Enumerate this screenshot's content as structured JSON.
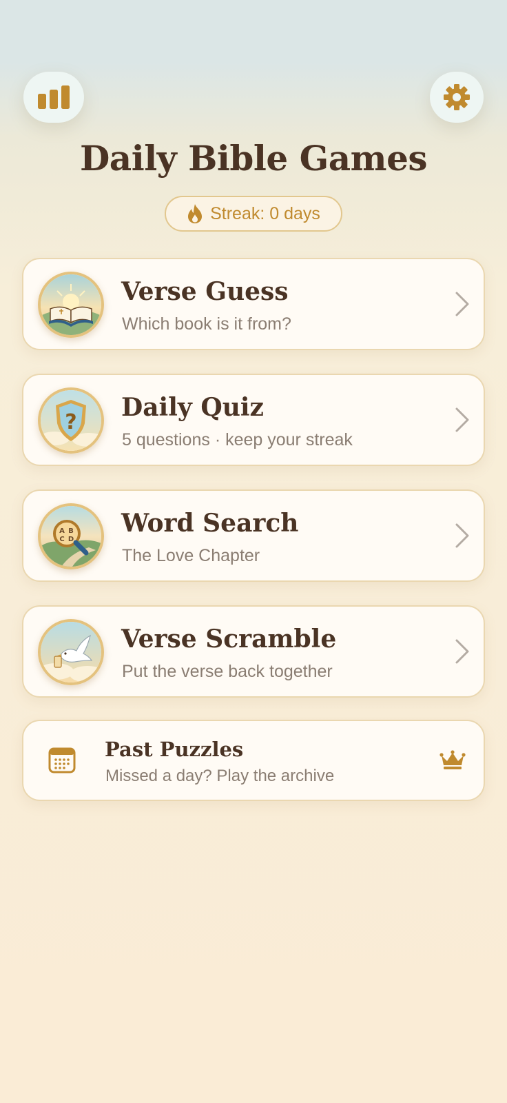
{
  "header": {
    "stats_icon": "bar-chart-icon",
    "settings_icon": "gear-icon",
    "title": "Daily Bible Games"
  },
  "streak": {
    "icon": "flame-icon",
    "label": "Streak: 0 days"
  },
  "games": [
    {
      "title": "Verse Guess",
      "subtitle": "Which book is it from?",
      "icon": "open-bible-icon"
    },
    {
      "title": "Daily Quiz",
      "subtitle": "5 questions · keep your streak",
      "icon": "question-shield-icon"
    },
    {
      "title": "Word Search",
      "subtitle": "The Love Chapter",
      "icon": "magnifier-letters-icon"
    },
    {
      "title": "Verse Scramble",
      "subtitle": "Put the verse back together",
      "icon": "dove-icon"
    }
  ],
  "past": {
    "title": "Past Puzzles",
    "subtitle": "Missed a day? Play the archive",
    "icon": "calendar-icon",
    "badge_icon": "crown-icon"
  },
  "colors": {
    "accent": "#c08a2e",
    "title_text": "#4a3324",
    "subtitle_text": "#8a7d72",
    "card_border": "#ead7b0"
  }
}
